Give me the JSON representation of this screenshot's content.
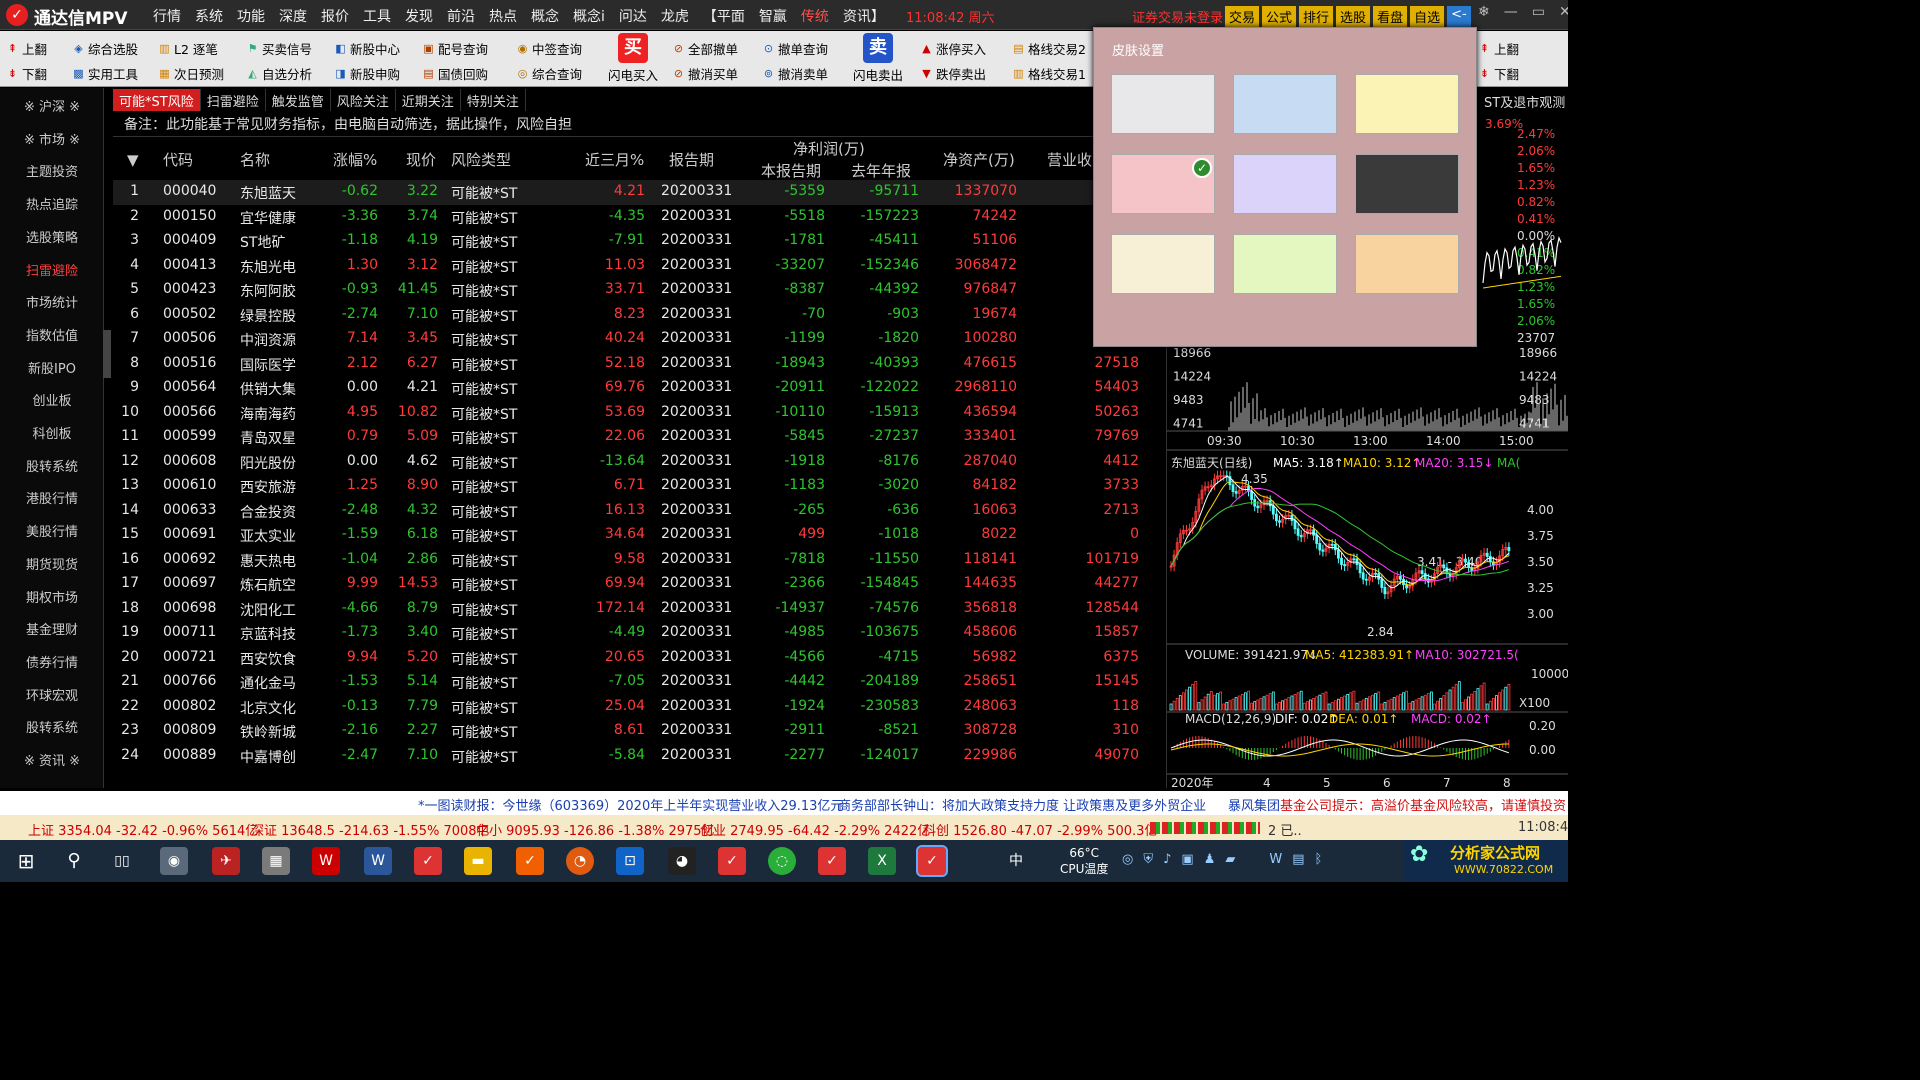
{
  "titlebar": {
    "app_name": "通达信MPV",
    "clock": "11:08:42 周六",
    "login_status": "证券交易未登录",
    "menus": [
      "行情",
      "系统",
      "功能",
      "深度",
      "报价",
      "工具",
      "发现",
      "前沿",
      "热点",
      "概念",
      "概念i",
      "问达",
      "龙虎",
      "【平面",
      "智赢",
      "传统",
      "资讯】"
    ],
    "active_menu": "传统",
    "buttons": [
      "交易",
      "公式",
      "排行",
      "选股",
      "看盘",
      "自选",
      "<-"
    ]
  },
  "toolbar": {
    "row1": [
      "上翻",
      "综合选股",
      "L2 逐笔",
      "买卖信号",
      "新股中心",
      "配号查询",
      "中签查询",
      "全部撤单",
      "撤单查询",
      "涨停买入",
      "格线交易2",
      "上翻"
    ],
    "row2": [
      "下翻",
      "实用工具",
      "次日预测",
      "自选分析",
      "新股申购",
      "国债回购",
      "综合查询",
      "撤消买单",
      "撤消卖单",
      "跌停卖出",
      "格线交易1",
      "下翻"
    ],
    "big_buy": "闪电买入",
    "big_sell": "闪电卖出",
    "big_buy_glyph": "买",
    "big_sell_glyph": "卖"
  },
  "leftnav": [
    "※ 沪深 ※",
    "※ 市场 ※",
    "主题投资",
    "热点追踪",
    "选股策略",
    "扫雷避险",
    "市场统计",
    "指数估值",
    "新股IPO",
    "创业板",
    "科创板",
    "股转系统",
    "港股行情",
    "美股行情",
    "期货现货",
    "期权市场",
    "基金理财",
    "债券行情",
    "环球宏观",
    "股转系统",
    "※ 资讯 ※"
  ],
  "leftnav_active": "扫雷避险",
  "tabs": [
    "可能*ST风险",
    "扫雷避险",
    "触发监管",
    "风险关注",
    "近期关注",
    "特别关注"
  ],
  "note": "备注：此功能基于常见财务指标，由电脑自动筛选，据此操作，风险自担",
  "table": {
    "headers": {
      "sort": "▼",
      "code": "代码",
      "name": "名称",
      "change": "涨幅%",
      "price": "现价",
      "risk": "风险类型",
      "q3": "近三月%",
      "period": "报告期",
      "netprofit": "净利润(万)",
      "np_current": "本报告期",
      "np_lastyear": "去年年报",
      "netasset": "净资产(万)",
      "revenue": "营业收"
    },
    "rows": [
      [
        "1",
        "000040",
        "东旭蓝天",
        "-0.62",
        "3.22",
        "可能被*ST",
        "4.21",
        "20200331",
        "-5359",
        "-95711",
        "1337070",
        ""
      ],
      [
        "2",
        "000150",
        "宜华健康",
        "-3.36",
        "3.74",
        "可能被*ST",
        "-4.35",
        "20200331",
        "-5518",
        "-157223",
        "74242",
        ""
      ],
      [
        "3",
        "000409",
        "ST地矿",
        "-1.18",
        "4.19",
        "可能被*ST",
        "-7.91",
        "20200331",
        "-1781",
        "-45411",
        "51106",
        ""
      ],
      [
        "4",
        "000413",
        "东旭光电",
        "1.30",
        "3.12",
        "可能被*ST",
        "11.03",
        "20200331",
        "-33207",
        "-152346",
        "3068472",
        ""
      ],
      [
        "5",
        "000423",
        "东阿阿胶",
        "-0.93",
        "41.45",
        "可能被*ST",
        "33.71",
        "20200331",
        "-8387",
        "-44392",
        "976847",
        ""
      ],
      [
        "6",
        "000502",
        "绿景控股",
        "-2.74",
        "7.10",
        "可能被*ST",
        "8.23",
        "20200331",
        "-70",
        "-903",
        "19674",
        ""
      ],
      [
        "7",
        "000506",
        "中润资源",
        "7.14",
        "3.45",
        "可能被*ST",
        "40.24",
        "20200331",
        "-1199",
        "-1820",
        "100280",
        ""
      ],
      [
        "8",
        "000516",
        "国际医学",
        "2.12",
        "6.27",
        "可能被*ST",
        "52.18",
        "20200331",
        "-18943",
        "-40393",
        "476615",
        "27518"
      ],
      [
        "9",
        "000564",
        "供销大集",
        "0.00",
        "4.21",
        "可能被*ST",
        "69.76",
        "20200331",
        "-20911",
        "-122022",
        "2968110",
        "54403"
      ],
      [
        "10",
        "000566",
        "海南海药",
        "4.95",
        "10.82",
        "可能被*ST",
        "53.69",
        "20200331",
        "-10110",
        "-15913",
        "436594",
        "50263"
      ],
      [
        "11",
        "000599",
        "青岛双星",
        "0.79",
        "5.09",
        "可能被*ST",
        "22.06",
        "20200331",
        "-5845",
        "-27237",
        "333401",
        "79769"
      ],
      [
        "12",
        "000608",
        "阳光股份",
        "0.00",
        "4.62",
        "可能被*ST",
        "-13.64",
        "20200331",
        "-1918",
        "-8176",
        "287040",
        "4412"
      ],
      [
        "13",
        "000610",
        "西安旅游",
        "1.25",
        "8.90",
        "可能被*ST",
        "6.71",
        "20200331",
        "-1183",
        "-3020",
        "84182",
        "3733"
      ],
      [
        "14",
        "000633",
        "合金投资",
        "-2.48",
        "4.32",
        "可能被*ST",
        "16.13",
        "20200331",
        "-265",
        "-636",
        "16063",
        "2713"
      ],
      [
        "15",
        "000691",
        "亚太实业",
        "-1.59",
        "6.18",
        "可能被*ST",
        "34.64",
        "20200331",
        "499",
        "-1018",
        "8022",
        "0"
      ],
      [
        "16",
        "000692",
        "惠天热电",
        "-1.04",
        "2.86",
        "可能被*ST",
        "9.58",
        "20200331",
        "-7818",
        "-11550",
        "118141",
        "101719"
      ],
      [
        "17",
        "000697",
        "炼石航空",
        "9.99",
        "14.53",
        "可能被*ST",
        "69.94",
        "20200331",
        "-2366",
        "-154845",
        "144635",
        "44277"
      ],
      [
        "18",
        "000698",
        "沈阳化工",
        "-4.66",
        "8.79",
        "可能被*ST",
        "172.14",
        "20200331",
        "-14937",
        "-74576",
        "356818",
        "128544"
      ],
      [
        "19",
        "000711",
        "京蓝科技",
        "-1.73",
        "3.40",
        "可能被*ST",
        "-4.49",
        "20200331",
        "-4985",
        "-103675",
        "458606",
        "15857"
      ],
      [
        "20",
        "000721",
        "西安饮食",
        "9.94",
        "5.20",
        "可能被*ST",
        "20.65",
        "20200331",
        "-4566",
        "-4715",
        "56982",
        "6375"
      ],
      [
        "21",
        "000766",
        "通化金马",
        "-1.53",
        "5.14",
        "可能被*ST",
        "-7.05",
        "20200331",
        "-4442",
        "-204189",
        "258651",
        "15145"
      ],
      [
        "22",
        "000802",
        "北京文化",
        "-0.13",
        "7.79",
        "可能被*ST",
        "25.04",
        "20200331",
        "-1924",
        "-230583",
        "248063",
        "118"
      ],
      [
        "23",
        "000809",
        "铁岭新城",
        "-2.16",
        "2.27",
        "可能被*ST",
        "8.61",
        "20200331",
        "-2911",
        "-8521",
        "308728",
        "310"
      ],
      [
        "24",
        "000889",
        "中嘉博创",
        "-2.47",
        "7.10",
        "可能被*ST",
        "-5.84",
        "20200331",
        "-2277",
        "-124017",
        "229986",
        "49070"
      ]
    ]
  },
  "skin": {
    "title": "皮肤设置",
    "colors": [
      "#e8e8ea",
      "#c7dbf3",
      "#fbf3b5",
      "#f4c4c8",
      "#dcd3fa",
      "#3a3a3a",
      "#f7efd6",
      "#e4f7c0",
      "#f8d3a0"
    ],
    "selected": 3
  },
  "right_panel": {
    "title": "ST及退市观测",
    "pct_top": "3.69%",
    "right_pcts": [
      "2.47%",
      "2.06%",
      "1.65%",
      "1.23%",
      "0.82%",
      "0.41%",
      "0.00%",
      "0.41%",
      "0.82%",
      "1.23%",
      "1.65%",
      "2.06%",
      "23707"
    ],
    "vol_labels": [
      "18966",
      "14224",
      "9483",
      "4741"
    ],
    "times": [
      "09:30",
      "10:30",
      "13:00",
      "14:00",
      "15:00"
    ],
    "kline_title": "东旭蓝天(日线)",
    "ma5": "MA5: 3.18↑",
    "ma10": "MA10: 3.12↑",
    "ma20": "MA20: 3.15↓",
    "ma_more": "MA(",
    "kline_high": "4.35",
    "kline_low": "2.84",
    "kline_range": "3.41 - 3.40",
    "kline_axis": [
      "4.00",
      "3.75",
      "3.50",
      "3.25",
      "3.00"
    ],
    "volume": "VOLUME: 391421.97↓",
    "vol_ma5": "MA5: 412383.91↑",
    "vol_ma10": "MA10: 302721.5(",
    "vol_axis": "10000",
    "vol_x": "X100",
    "macd": "MACD(12,26,9)",
    "dif": "DIF: 0.02↑",
    "dea": "DEA: 0.01↑",
    "macd_v": "MACD: 0.02↑",
    "macd_axis": [
      "0.20",
      "0.00"
    ],
    "years": [
      "2020年",
      "4",
      "5",
      "6",
      "7",
      "8"
    ]
  },
  "ticker": {
    "a": "*一图读财报：今世缘（603369）2020年上半年实现营业收入29.13亿元",
    "b": "商务部部长钟山：将加大政策支持力度 让政策惠及更多外贸企业",
    "c": "暴风集团",
    "d": "基金公司提示：高溢价基金风险较高，请谨慎投资"
  },
  "status": {
    "sh": "上证 3354.04 -32.42 -0.96% 5614亿",
    "sz": "深证 13648.5 -214.63 -1.55% 7008亿",
    "zx": "中小 9095.93 -126.86 -1.38% 2975亿",
    "cy": "创业 2749.95 -64.42 -2.29% 2422亿",
    "kc": "科创 1526.80 -47.07 -2.99% 500.3亿",
    "misc": "2 已..",
    "time": "11:08:44"
  },
  "taskbar": {
    "temp": "66°C",
    "temp_label": "CPU温度",
    "watermark": "分析家公式网",
    "watermark_url": "WWW.70822.COM"
  },
  "colors": {
    "up": "#ff3b3b",
    "down": "#2ec52e",
    "accent": "#d21e1e"
  }
}
